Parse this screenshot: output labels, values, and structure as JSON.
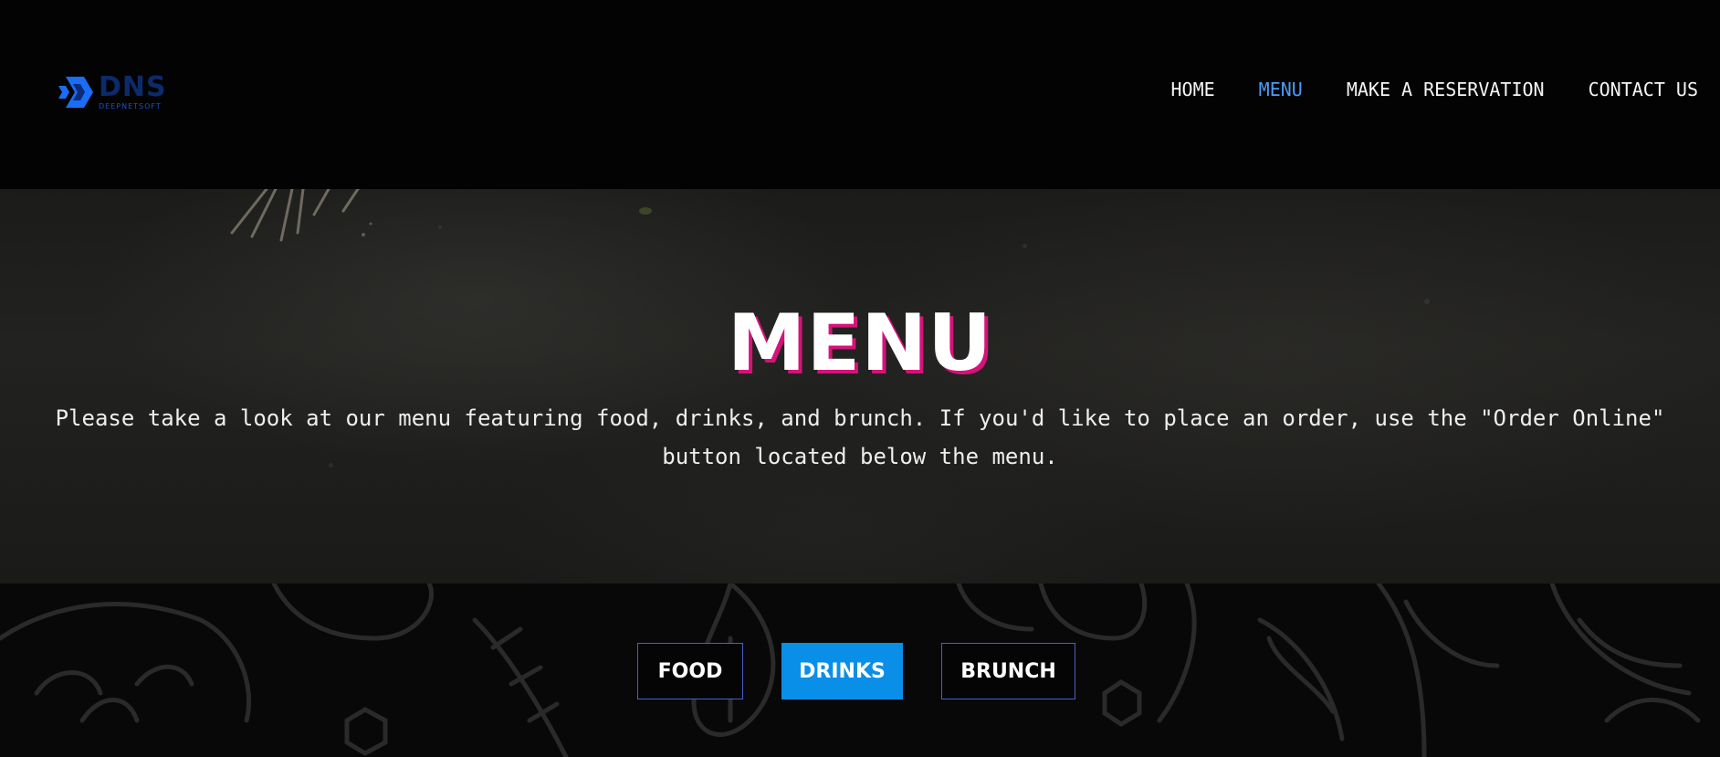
{
  "logo": {
    "word": "DNS",
    "subtitle": "DEEPNETSOFT",
    "icon": "dns-logo-icon"
  },
  "nav": {
    "items": [
      {
        "label": "HOME",
        "active": false
      },
      {
        "label": "MENU",
        "active": true
      },
      {
        "label": "MAKE A RESERVATION",
        "active": false
      },
      {
        "label": "CONTACT US",
        "active": false
      }
    ]
  },
  "hero": {
    "title": "MENU",
    "description": "Please take a look at our menu featuring food, drinks, and brunch. If you'd like to place an order, use the \"Order Online\" button located below the menu."
  },
  "tabs": {
    "items": [
      {
        "label": "FOOD",
        "active": false
      },
      {
        "label": "DRINKS",
        "active": true
      },
      {
        "label": "BRUNCH",
        "active": false
      }
    ]
  },
  "colors": {
    "nav_active": "#4e9cf3",
    "title_shadow": "#d6127a",
    "tab_active_bg": "#0a8fe8",
    "tab_border": "#4a5fc7",
    "logo_blue": "#1a52c8"
  }
}
